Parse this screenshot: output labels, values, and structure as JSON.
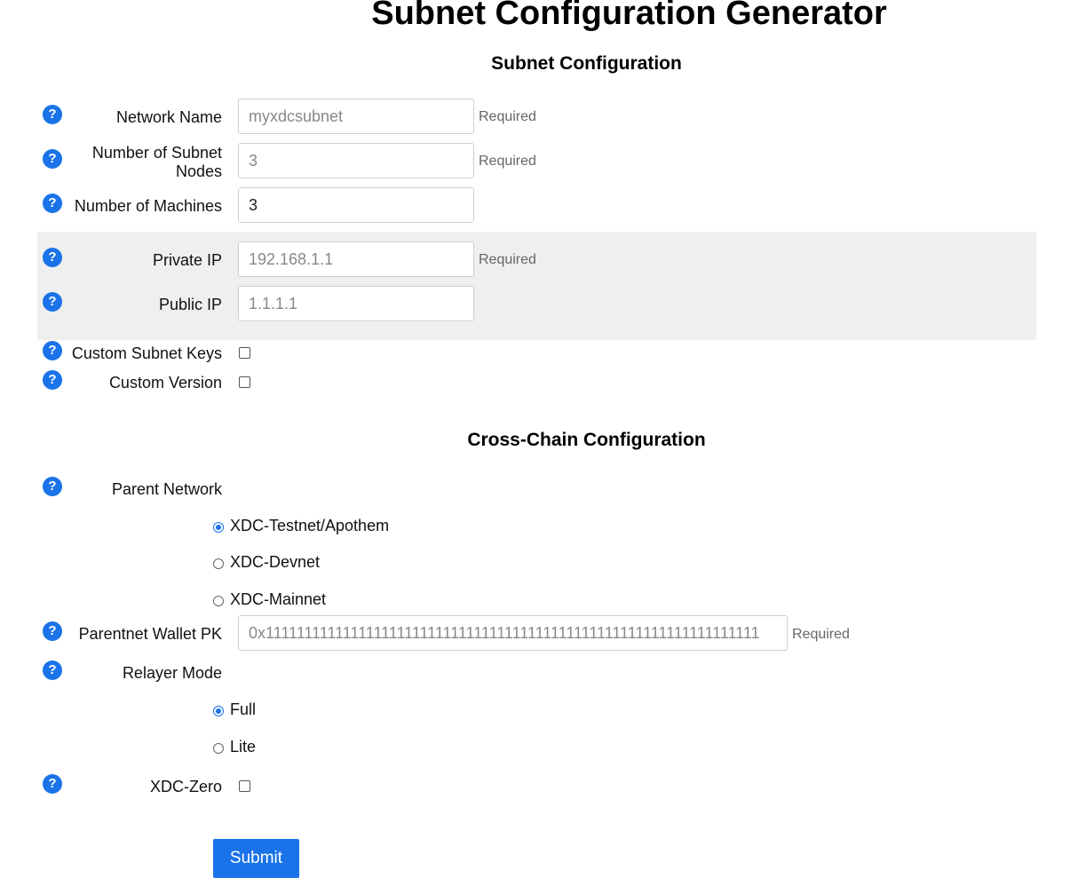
{
  "page_title": "Subnet Configuration Generator",
  "subnet_section": {
    "title": "Subnet Configuration",
    "network_name": {
      "label": "Network Name",
      "placeholder": "myxdcsubnet",
      "required": "Required"
    },
    "num_subnet_nodes": {
      "label_line1": "Number of Subnet",
      "label_line2": "Nodes",
      "placeholder": "3",
      "required": "Required"
    },
    "num_machines": {
      "label": "Number of Machines",
      "value": "3"
    },
    "private_ip": {
      "label": "Private IP",
      "placeholder": "192.168.1.1",
      "required": "Required"
    },
    "public_ip": {
      "label": "Public IP",
      "placeholder": "1.1.1.1"
    },
    "custom_subnet_keys": {
      "label": "Custom Subnet Keys",
      "checked": false
    },
    "custom_version": {
      "label": "Custom Version",
      "checked": false
    }
  },
  "crosschain_section": {
    "title": "Cross-Chain Configuration",
    "parent_network": {
      "label": "Parent Network",
      "options": [
        "XDC-Testnet/Apothem",
        "XDC-Devnet",
        "XDC-Mainnet"
      ],
      "selected": "XDC-Testnet/Apothem"
    },
    "parentnet_wallet_pk": {
      "label": "Parentnet Wallet PK",
      "placeholder": "0x1111111111111111111111111111111111111111111111111111111111111111",
      "required": "Required"
    },
    "relayer_mode": {
      "label": "Relayer Mode",
      "options": [
        "Full",
        "Lite"
      ],
      "selected": "Full"
    },
    "xdc_zero": {
      "label": "XDC-Zero",
      "checked": false
    }
  },
  "submit_label": "Submit",
  "help_glyph": "?",
  "icons": {
    "help": "question-circle-icon"
  },
  "colors": {
    "accent": "#1a73e8",
    "band": "#efefef"
  }
}
